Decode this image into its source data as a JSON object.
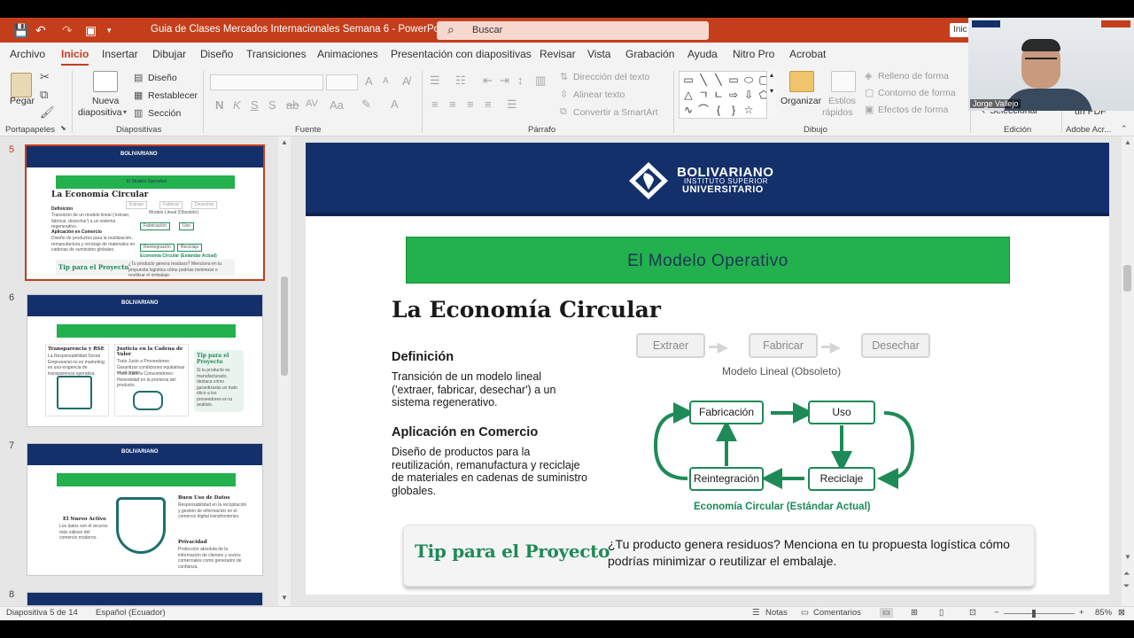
{
  "window": {
    "title": "Guia de Clases Mercados Internacionales Semana 6  -  PowerPoint",
    "search_label": "Buscar",
    "right_button": "Inic"
  },
  "tabs": [
    "Archivo",
    "Inicio",
    "Insertar",
    "Dibujar",
    "Diseño",
    "Transiciones",
    "Animaciones",
    "Presentación con diapositivas",
    "Revisar",
    "Vista",
    "Grabación",
    "Ayuda",
    "Nitro Pro",
    "Acrobat"
  ],
  "active_tab": "Inicio",
  "ribbon": {
    "portapapeles": {
      "label": "Portapapeles",
      "pegar": "Pegar"
    },
    "diapositivas": {
      "label": "Diapositivas",
      "nueva": "Nueva",
      "nueva2": "diapositiva",
      "diseno": "Diseño",
      "restablecer": "Restablecer",
      "seccion": "Sección"
    },
    "fuente": {
      "label": "Fuente",
      "bold": "N",
      "italic": "K",
      "underline": "S",
      "strike": "S",
      "spacing": "AV",
      "case": "Aa"
    },
    "parrafo": {
      "label": "Párrafo",
      "direccion": "Dirección del texto",
      "alinear": "Alinear texto",
      "convertir": "Convertir a SmartArt"
    },
    "dibujo": {
      "label": "Dibujo",
      "organizar": "Organizar",
      "estilos1": "Estilos",
      "estilos2": "rápidos",
      "relleno": "Relleno de forma",
      "contorno": "Contorno de forma",
      "efectos": "Efectos de forma"
    },
    "edicion": {
      "label": "Edición",
      "seleccionar": "Seleccionar"
    },
    "adobe": {
      "label": "Adobe Acr...",
      "pdf": "un PDF"
    }
  },
  "thumbnails": [
    {
      "num": "5",
      "selected": true,
      "band": "El Modelo Operativo",
      "title": "La Economía Circular",
      "h1": "Definición",
      "b1": "Transición de un modelo lineal ('extraer, fabricar, desechar') a un sistema regenerativo.",
      "h2": "Aplicación en Comercio",
      "b2": "Diseño de productos para la reutilización, remanufactura y reciclaje de materiales en cadenas de suministro globales.",
      "tip": "Tip para el Proyecto",
      "tiptext": "¿Tu producto genera residuos? Menciona en tu propuesta logística cómo podrías minimizar o reutilizar el embalaje.",
      "lin": [
        "Extraer",
        "Fabricar",
        "Desechar"
      ],
      "lincap": "Modelo Lineal (Obsoleto)",
      "circ": [
        "Fabricación",
        "Uso",
        "Reintegración",
        "Reciclaje"
      ],
      "circcap": "Economía Circular (Estándar Actual)"
    },
    {
      "num": "6",
      "selected": false,
      "c1": "Transparencia y RSE",
      "c1b": "La Responsabilidad Social Empresarial no es marketing; es una exigencia de transparencia operativa.",
      "c2": "Justicia en la Cadena de Valor",
      "c2b1": "Trato Justo a Proveedores: Garantizar condiciones equitativas en el origen.",
      "c2b2": "Trato Justo a Consumidores: Honestidad en la promesa del producto.",
      "c3": "Tip para el Proyecto",
      "c3b": "Si tu producto es manufacturado, destaca cómo garantizarás un trato ético a los proveedores en tu análisis."
    },
    {
      "num": "7",
      "selected": false,
      "l1": "El Nuevo Activo",
      "l1b": "Los datos son el recurso más valioso del comercio moderno.",
      "r1": "Buen Uso de Datos",
      "r1b": "Responsabilidad en la recopilación y gestión de información en el comercio digital transfronterizo.",
      "r2": "Privacidad",
      "r2b": "Protección absoluta de la información de clientes y socios comerciales como generador de confianza."
    },
    {
      "num": "8",
      "selected": false
    }
  ],
  "slide": {
    "logo": {
      "name": "BOLIVARIANO",
      "sub1": "INSTITUTO SUPERIOR",
      "sub2": "UNIVERSITARIO"
    },
    "band": "El Modelo Operativo",
    "title": "La Economía Circular",
    "definicion_head": "Definición",
    "definicion_lines": [
      "Transición de un modelo lineal",
      "('extraer, fabricar, desechar') a un",
      "sistema regenerativo."
    ],
    "comercio_head": "Aplicación en Comercio",
    "comercio_lines": [
      "Diseño de productos para la",
      "reutilización, remanufactura y reciclaje",
      "de materiales en cadenas de suministro",
      "globales."
    ],
    "linear": [
      "Extraer",
      "Fabricar",
      "Desechar"
    ],
    "linear_caption": "Modelo Lineal (Obsoleto)",
    "circular": {
      "top_left": "Fabricación",
      "top_right": "Uso",
      "bottom_left": "Reintegración",
      "bottom_right": "Reciclaje"
    },
    "circular_caption": "Economía Circular (Estándar Actual)",
    "tip_title": "Tip para el Proyecto",
    "tip_lines": [
      "¿Tu producto genera residuos? Menciona en tu propuesta logística cómo",
      "podrías minimizar o reutilizar el embalaje."
    ]
  },
  "status": {
    "slide_pos": "Diapositiva 5 de 14",
    "language": "Español (Ecuador)",
    "notas": "Notas",
    "comentarios": "Comentarios",
    "zoom": "85%"
  },
  "webcam": {
    "name": "Jorge Vallejo"
  },
  "colors": {
    "accent": "#c43e1c",
    "navy": "#14306b",
    "green": "#22b14c",
    "dark_green": "#1e8a57"
  }
}
